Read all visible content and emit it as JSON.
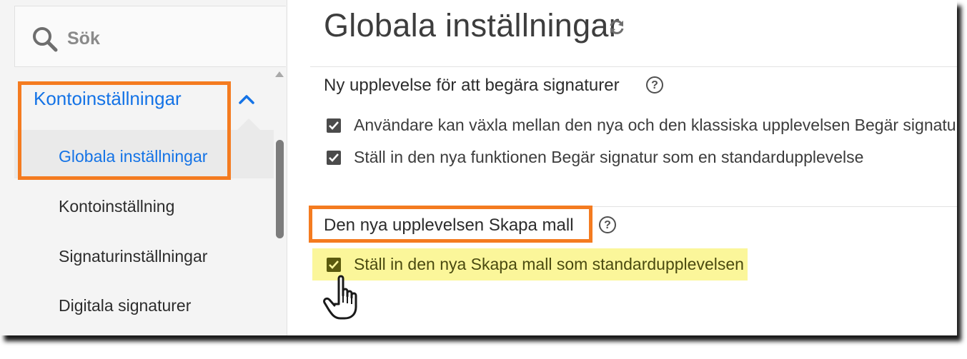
{
  "search": {
    "placeholder": "Sök",
    "icon": "search-icon"
  },
  "sidebar": {
    "group": {
      "label": "Kontoinställningar",
      "expanded": true
    },
    "items": [
      {
        "label": "Globala inställningar",
        "active": true
      },
      {
        "label": "Kontoinställning",
        "active": false
      },
      {
        "label": "Signaturinställningar",
        "active": false
      },
      {
        "label": "Digitala signaturer",
        "active": false
      }
    ]
  },
  "main": {
    "title": "Globala inställningar",
    "sections": [
      {
        "heading": "Ny upplevelse för att begära signaturer",
        "options": [
          {
            "label": "Användare kan växla mellan den nya och den klassiska upplevelsen Begär signatur",
            "checked": true
          },
          {
            "label": "Ställ in den nya funktionen Begär signatur som en standardupplevelse",
            "checked": true
          }
        ]
      },
      {
        "heading": "Den nya upplevelsen Skapa mall",
        "options": [
          {
            "label": "Ställ in den nya Skapa mall som standardupplevelsen",
            "checked": true,
            "highlighted": true
          }
        ]
      }
    ]
  },
  "colors": {
    "accent": "#1473e6",
    "annotation_orange": "#f47b20",
    "highlight_yellow": "#fbf69a"
  }
}
